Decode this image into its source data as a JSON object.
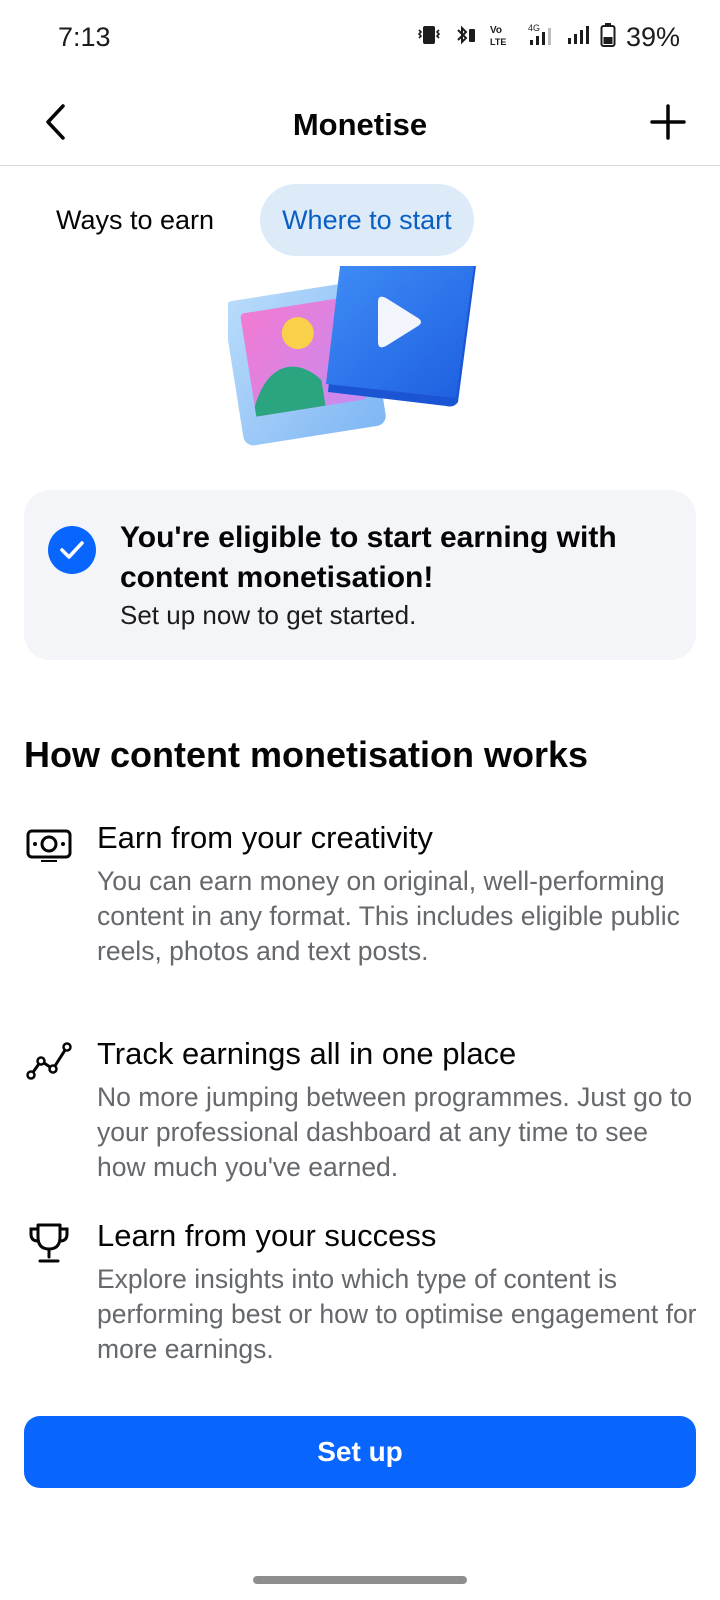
{
  "status_bar": {
    "time": "7:13",
    "battery_percent": "39%",
    "icons": [
      "vibrate-icon",
      "bluetooth-icon",
      "volte-icon",
      "signal-4g-icon",
      "signal-icon",
      "battery-icon"
    ]
  },
  "header": {
    "title": "Monetise",
    "back_icon": "chevron-left-icon",
    "add_icon": "plus-icon"
  },
  "tabs": [
    {
      "label": "Ways to earn",
      "active": false
    },
    {
      "label": "Where to start",
      "active": true
    }
  ],
  "eligibility_card": {
    "title": "You're eligible to start earning with content monetisation!",
    "subtitle": "Set up now to get started.",
    "icon": "check-circle-icon"
  },
  "section": {
    "title": "How content monetisation works",
    "features": [
      {
        "icon": "money-icon",
        "title": "Earn from your creativity",
        "description": "You can earn money on original, well-performing content in any format. This includes eligible public reels, photos and text posts."
      },
      {
        "icon": "trend-line-icon",
        "title": "Track earnings all in one place",
        "description": "No more jumping between programmes. Just go to your professional dashboard at any time to see how much you've earned."
      },
      {
        "icon": "trophy-icon",
        "title": "Learn from your success",
        "description": "Explore insights into which type of content is performing best or how to optimise engagement for more earnings."
      }
    ]
  },
  "setup_button": {
    "label": "Set up"
  },
  "colors": {
    "accent": "#0866ff",
    "active_tab_bg": "#ddeaf8",
    "active_tab_text": "#0a5fc4",
    "card_bg": "#f3f5f8",
    "secondary_text": "#65686c"
  }
}
